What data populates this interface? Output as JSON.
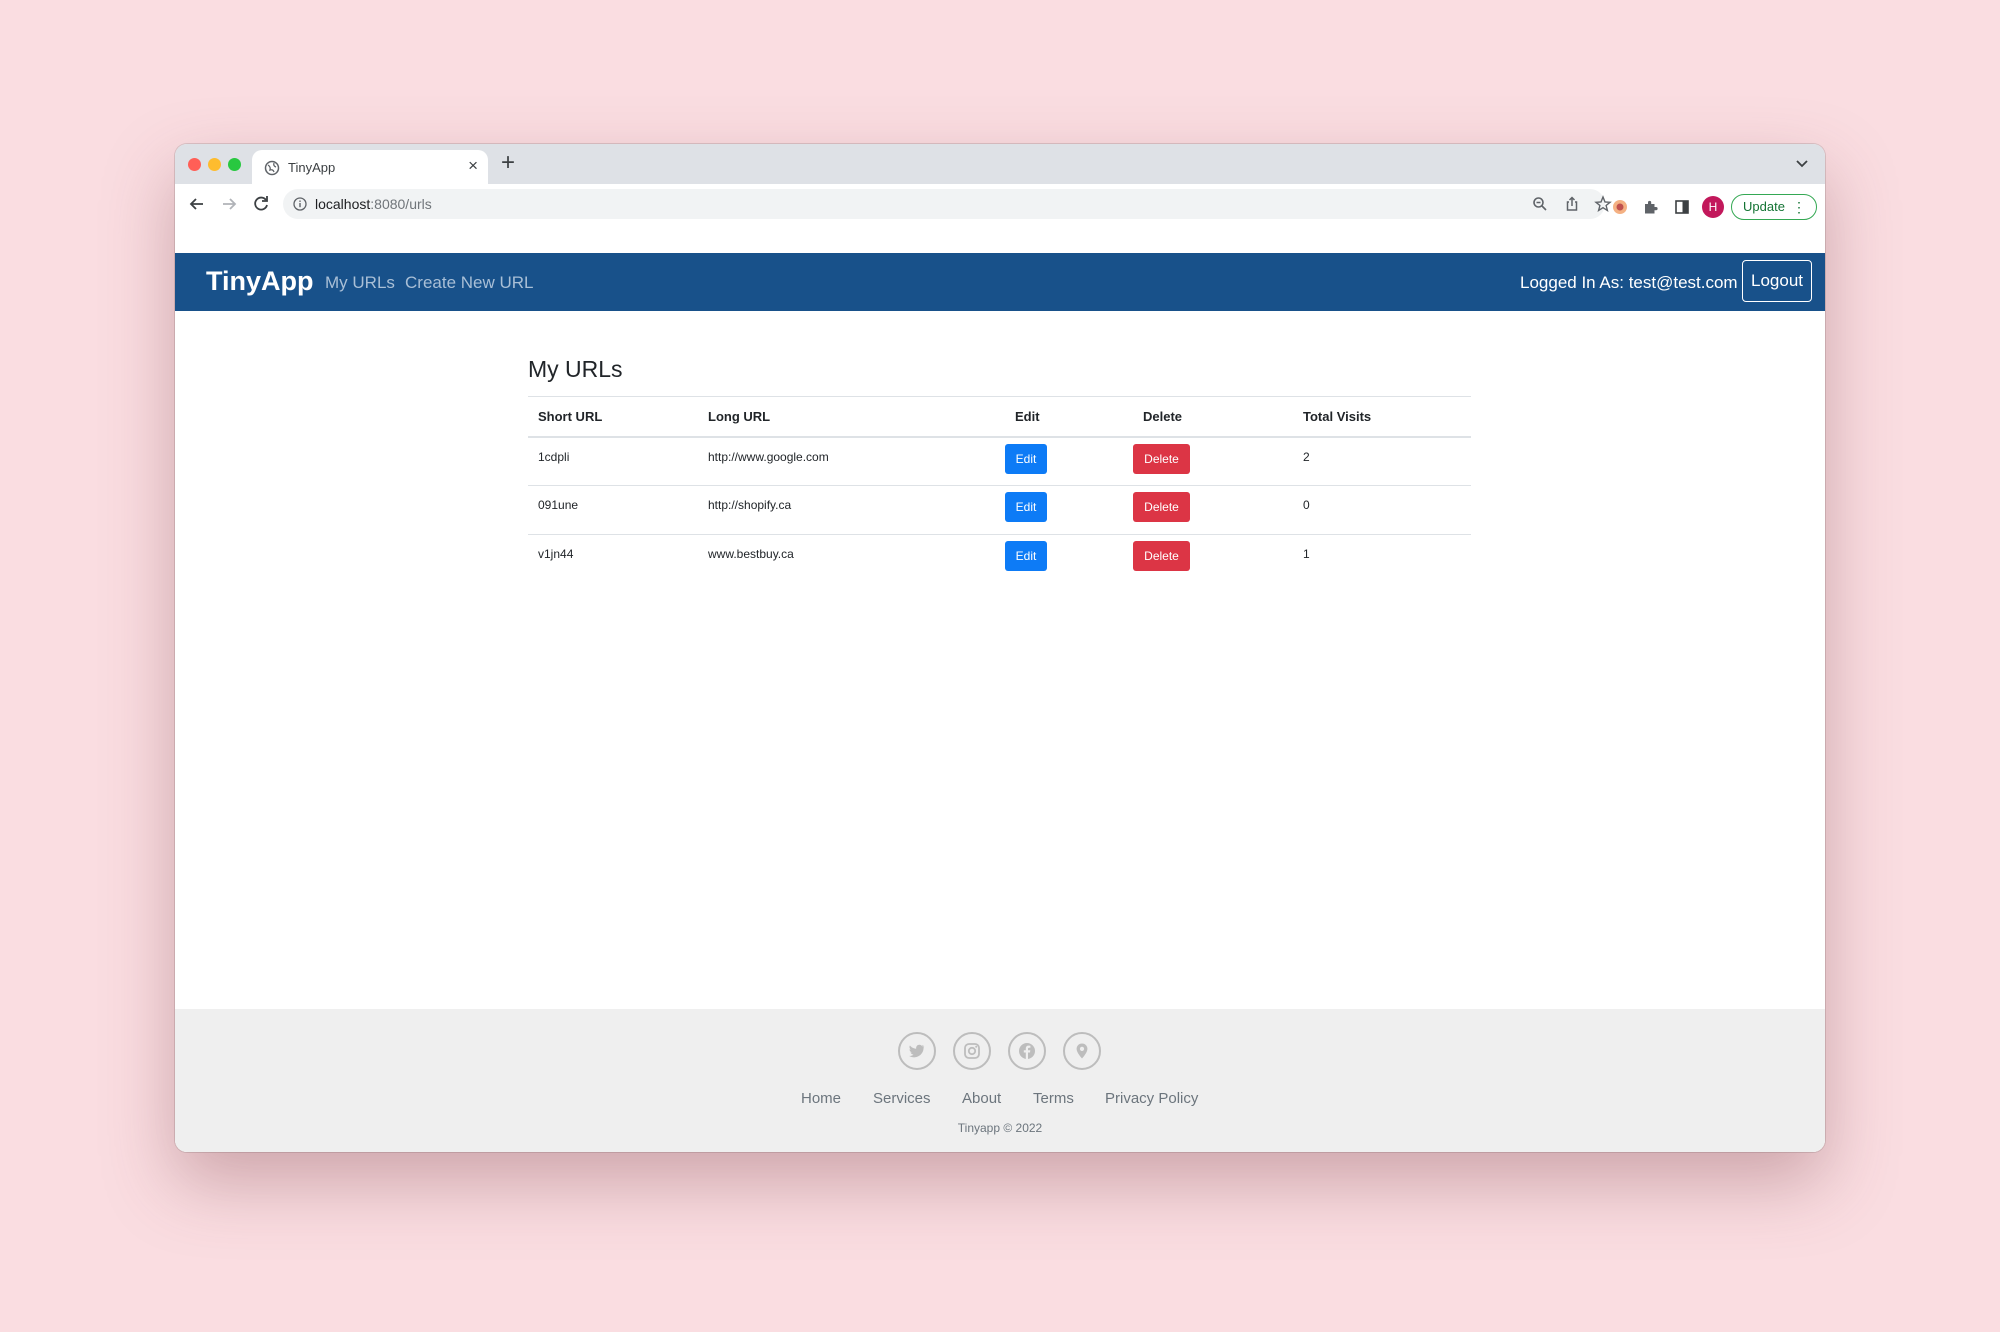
{
  "browser": {
    "tab_title": "TinyApp",
    "url_host": "localhost",
    "url_rest": ":8080/urls",
    "avatar_letter": "H",
    "update_label": "Update"
  },
  "navbar": {
    "brand": "TinyApp",
    "links": [
      "My URLs",
      "Create New URL"
    ],
    "logged_in_text": "Logged In As: test@test.com",
    "logout_label": "Logout",
    "bg_color": "#18518a"
  },
  "main": {
    "title": "My URLs",
    "columns": [
      "Short URL",
      "Long URL",
      "Edit",
      "Delete",
      "Total Visits"
    ],
    "rows": [
      {
        "short": "1cdpli",
        "long": "http://www.google.com",
        "edit": "Edit",
        "delete": "Delete",
        "visits": "2"
      },
      {
        "short": "091une",
        "long": "http://shopify.ca",
        "edit": "Edit",
        "delete": "Delete",
        "visits": "0"
      },
      {
        "short": "v1jn44",
        "long": "www.bestbuy.ca",
        "edit": "Edit",
        "delete": "Delete",
        "visits": "1"
      }
    ]
  },
  "footer": {
    "social_icons": [
      "twitter-icon",
      "instagram-icon",
      "facebook-icon",
      "location-icon"
    ],
    "links": [
      "Home",
      "Services",
      "About",
      "Terms",
      "Privacy Policy"
    ],
    "copyright": "Tinyapp © 2022"
  }
}
